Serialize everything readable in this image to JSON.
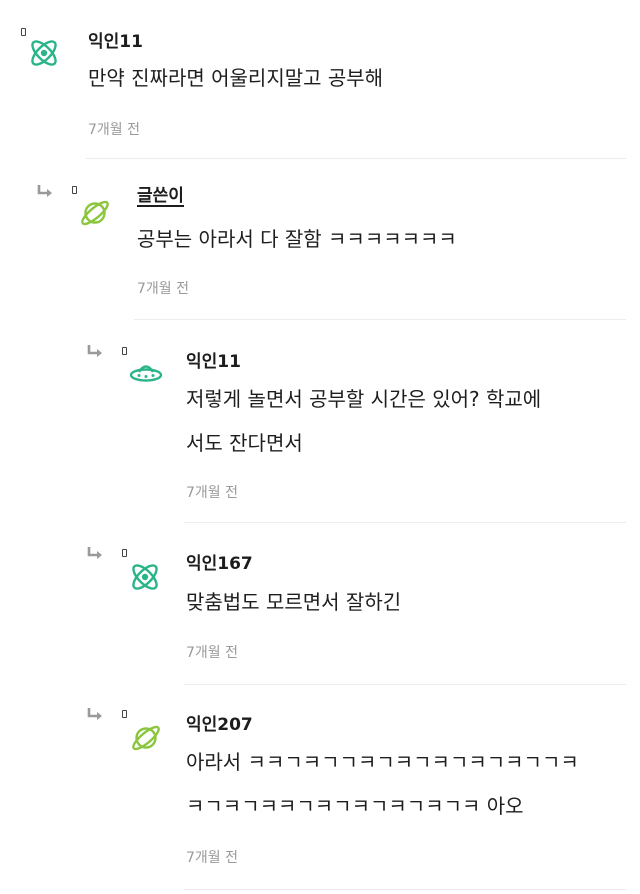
{
  "comments": [
    {
      "author": "익인11",
      "lines": [
        "만약 진짜라면 어울리지말고 공부해"
      ],
      "time": "7개월 전",
      "avatar_icon": "atom-icon",
      "avatar_color": "#2bb48a"
    },
    {
      "author": "글쓴이",
      "lines": [
        "공부는 아라서 다 잘함 ㅋㅋㅋㅋㅋㅋㅋ"
      ],
      "time": "7개월 전",
      "avatar_icon": "planet-icon",
      "avatar_color": "#8cc63f"
    },
    {
      "author": "익인11",
      "lines": [
        "저렇게 놀면서 공부할 시간은 있어? 학교에",
        "서도 잔다면서"
      ],
      "time": "7개월 전",
      "avatar_icon": "ufo-icon",
      "avatar_color": "#2bb48a"
    },
    {
      "author": "익인167",
      "lines": [
        "맞춤법도 모르면서 잘하긴"
      ],
      "time": "7개월 전",
      "avatar_icon": "atom-icon",
      "avatar_color": "#2bb48a"
    },
    {
      "author": "익인207",
      "lines": [
        "아라서 ㅋㅋㄱㅋㄱㄱㅋㄱㅋㄱㅋㄱㅋㄱㅋㄱㄱㅋ",
        "ㅋㄱㅋㄱㅋㅋㄱㅋㄱㅋㄱㅋㄱㅋㄱㅋ 아오"
      ],
      "time": "7개월 전",
      "avatar_icon": "planet-icon",
      "avatar_color": "#8cc63f"
    }
  ]
}
